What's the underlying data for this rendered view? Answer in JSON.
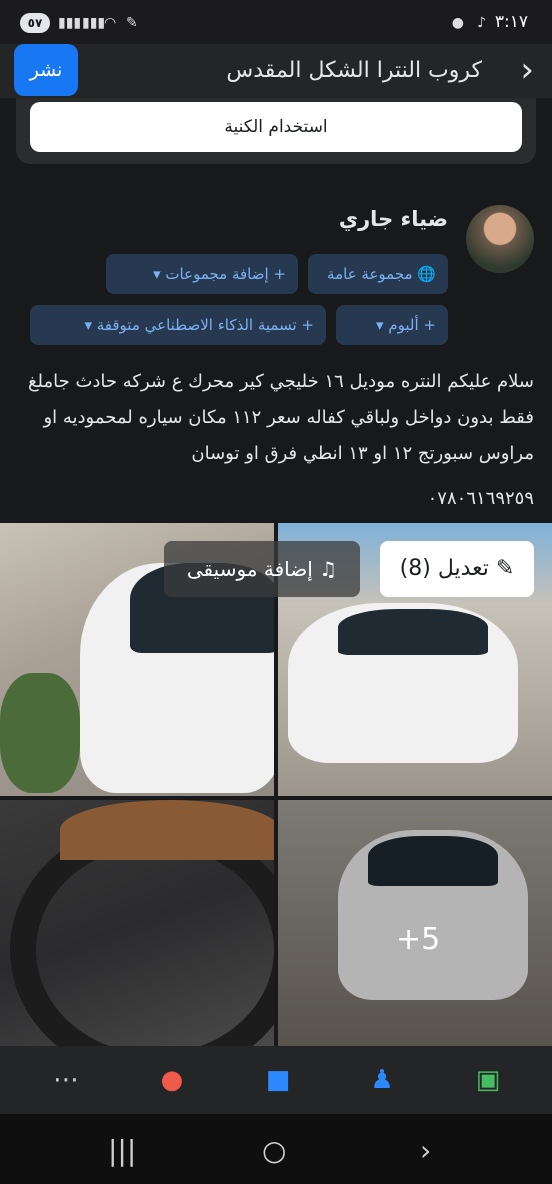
{
  "status_bar": {
    "time": "٣:١٧",
    "battery": "٥٧"
  },
  "header": {
    "title": "كروب النترا الشكل المقدس",
    "publish": "نشر"
  },
  "nickname_button": "استخدام الكنية",
  "author": {
    "name": "ضياء جاري"
  },
  "chips": {
    "audience": "مجموعة عامة",
    "add_groups": "+ إضافة مجموعات",
    "album": "+ ألبوم",
    "ai_label": "+ تسمية الذكاء الاصطناعي متوقفة"
  },
  "post": {
    "text": "سلام عليكم النتره موديل ١٦ خليجي كير محرك ع شركه حادث جاملغ فقط بدون دواخل ولباقي كفاله سعر ١١٢ مكان سياره لمحموديه او مراوس سبورتج  ١٢ او ١٣ انطي فرق او توسان",
    "phone": "٠٧٨٠٦١٦٩٢٥٩"
  },
  "photos": {
    "edit_label": "تعديل (8)",
    "music_label": "إضافة موسيقى",
    "more_count": "+5"
  },
  "colors": {
    "accent": "#1877f2",
    "background": "#18191a",
    "chip_bg": "#263951"
  }
}
